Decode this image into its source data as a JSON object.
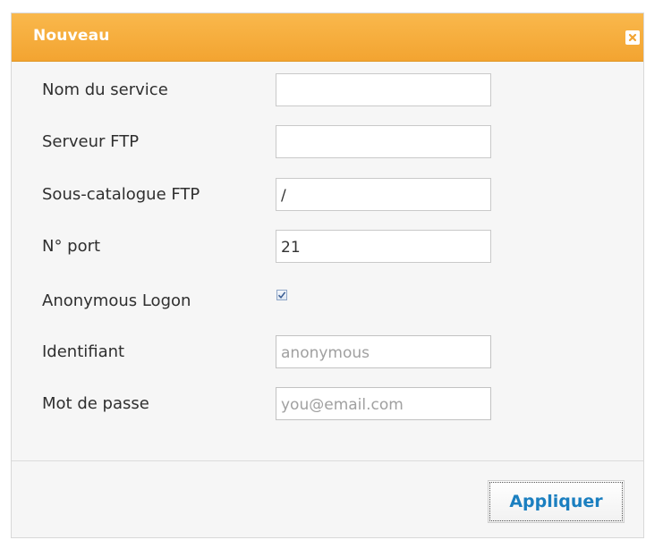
{
  "dialog": {
    "title": "Nouveau",
    "close_icon": "close-icon"
  },
  "form": {
    "service_name": {
      "label": "Nom du service",
      "value": ""
    },
    "ftp_server": {
      "label": "Serveur FTP",
      "value": ""
    },
    "ftp_subdir": {
      "label": "Sous-catalogue FTP",
      "value": "/"
    },
    "port": {
      "label": "N° port",
      "value": "21"
    },
    "anonymous_logon": {
      "label": "Anonymous Logon",
      "checked": true
    },
    "username": {
      "label": "Identifiant",
      "placeholder": "anonymous"
    },
    "password": {
      "label": "Mot de passe",
      "placeholder": "you@email.com"
    }
  },
  "footer": {
    "apply_label": "Appliquer"
  },
  "colors": {
    "titlebar": "#f3a431",
    "apply_text": "#1b7fc0"
  }
}
